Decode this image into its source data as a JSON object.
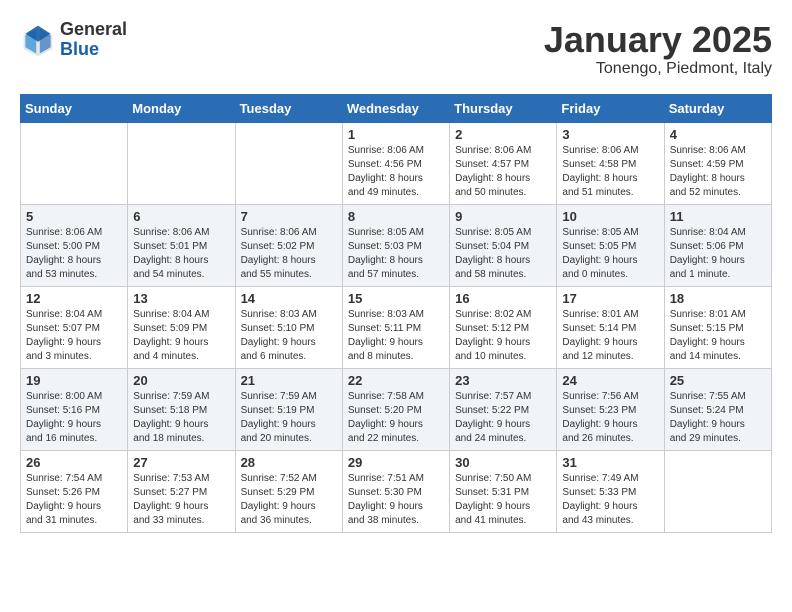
{
  "logo": {
    "general": "General",
    "blue": "Blue"
  },
  "title": "January 2025",
  "subtitle": "Tonengo, Piedmont, Italy",
  "days_of_week": [
    "Sunday",
    "Monday",
    "Tuesday",
    "Wednesday",
    "Thursday",
    "Friday",
    "Saturday"
  ],
  "weeks": [
    [
      {
        "day": "",
        "info": ""
      },
      {
        "day": "",
        "info": ""
      },
      {
        "day": "",
        "info": ""
      },
      {
        "day": "1",
        "info": "Sunrise: 8:06 AM\nSunset: 4:56 PM\nDaylight: 8 hours\nand 49 minutes."
      },
      {
        "day": "2",
        "info": "Sunrise: 8:06 AM\nSunset: 4:57 PM\nDaylight: 8 hours\nand 50 minutes."
      },
      {
        "day": "3",
        "info": "Sunrise: 8:06 AM\nSunset: 4:58 PM\nDaylight: 8 hours\nand 51 minutes."
      },
      {
        "day": "4",
        "info": "Sunrise: 8:06 AM\nSunset: 4:59 PM\nDaylight: 8 hours\nand 52 minutes."
      }
    ],
    [
      {
        "day": "5",
        "info": "Sunrise: 8:06 AM\nSunset: 5:00 PM\nDaylight: 8 hours\nand 53 minutes."
      },
      {
        "day": "6",
        "info": "Sunrise: 8:06 AM\nSunset: 5:01 PM\nDaylight: 8 hours\nand 54 minutes."
      },
      {
        "day": "7",
        "info": "Sunrise: 8:06 AM\nSunset: 5:02 PM\nDaylight: 8 hours\nand 55 minutes."
      },
      {
        "day": "8",
        "info": "Sunrise: 8:05 AM\nSunset: 5:03 PM\nDaylight: 8 hours\nand 57 minutes."
      },
      {
        "day": "9",
        "info": "Sunrise: 8:05 AM\nSunset: 5:04 PM\nDaylight: 8 hours\nand 58 minutes."
      },
      {
        "day": "10",
        "info": "Sunrise: 8:05 AM\nSunset: 5:05 PM\nDaylight: 9 hours\nand 0 minutes."
      },
      {
        "day": "11",
        "info": "Sunrise: 8:04 AM\nSunset: 5:06 PM\nDaylight: 9 hours\nand 1 minute."
      }
    ],
    [
      {
        "day": "12",
        "info": "Sunrise: 8:04 AM\nSunset: 5:07 PM\nDaylight: 9 hours\nand 3 minutes."
      },
      {
        "day": "13",
        "info": "Sunrise: 8:04 AM\nSunset: 5:09 PM\nDaylight: 9 hours\nand 4 minutes."
      },
      {
        "day": "14",
        "info": "Sunrise: 8:03 AM\nSunset: 5:10 PM\nDaylight: 9 hours\nand 6 minutes."
      },
      {
        "day": "15",
        "info": "Sunrise: 8:03 AM\nSunset: 5:11 PM\nDaylight: 9 hours\nand 8 minutes."
      },
      {
        "day": "16",
        "info": "Sunrise: 8:02 AM\nSunset: 5:12 PM\nDaylight: 9 hours\nand 10 minutes."
      },
      {
        "day": "17",
        "info": "Sunrise: 8:01 AM\nSunset: 5:14 PM\nDaylight: 9 hours\nand 12 minutes."
      },
      {
        "day": "18",
        "info": "Sunrise: 8:01 AM\nSunset: 5:15 PM\nDaylight: 9 hours\nand 14 minutes."
      }
    ],
    [
      {
        "day": "19",
        "info": "Sunrise: 8:00 AM\nSunset: 5:16 PM\nDaylight: 9 hours\nand 16 minutes."
      },
      {
        "day": "20",
        "info": "Sunrise: 7:59 AM\nSunset: 5:18 PM\nDaylight: 9 hours\nand 18 minutes."
      },
      {
        "day": "21",
        "info": "Sunrise: 7:59 AM\nSunset: 5:19 PM\nDaylight: 9 hours\nand 20 minutes."
      },
      {
        "day": "22",
        "info": "Sunrise: 7:58 AM\nSunset: 5:20 PM\nDaylight: 9 hours\nand 22 minutes."
      },
      {
        "day": "23",
        "info": "Sunrise: 7:57 AM\nSunset: 5:22 PM\nDaylight: 9 hours\nand 24 minutes."
      },
      {
        "day": "24",
        "info": "Sunrise: 7:56 AM\nSunset: 5:23 PM\nDaylight: 9 hours\nand 26 minutes."
      },
      {
        "day": "25",
        "info": "Sunrise: 7:55 AM\nSunset: 5:24 PM\nDaylight: 9 hours\nand 29 minutes."
      }
    ],
    [
      {
        "day": "26",
        "info": "Sunrise: 7:54 AM\nSunset: 5:26 PM\nDaylight: 9 hours\nand 31 minutes."
      },
      {
        "day": "27",
        "info": "Sunrise: 7:53 AM\nSunset: 5:27 PM\nDaylight: 9 hours\nand 33 minutes."
      },
      {
        "day": "28",
        "info": "Sunrise: 7:52 AM\nSunset: 5:29 PM\nDaylight: 9 hours\nand 36 minutes."
      },
      {
        "day": "29",
        "info": "Sunrise: 7:51 AM\nSunset: 5:30 PM\nDaylight: 9 hours\nand 38 minutes."
      },
      {
        "day": "30",
        "info": "Sunrise: 7:50 AM\nSunset: 5:31 PM\nDaylight: 9 hours\nand 41 minutes."
      },
      {
        "day": "31",
        "info": "Sunrise: 7:49 AM\nSunset: 5:33 PM\nDaylight: 9 hours\nand 43 minutes."
      },
      {
        "day": "",
        "info": ""
      }
    ]
  ]
}
